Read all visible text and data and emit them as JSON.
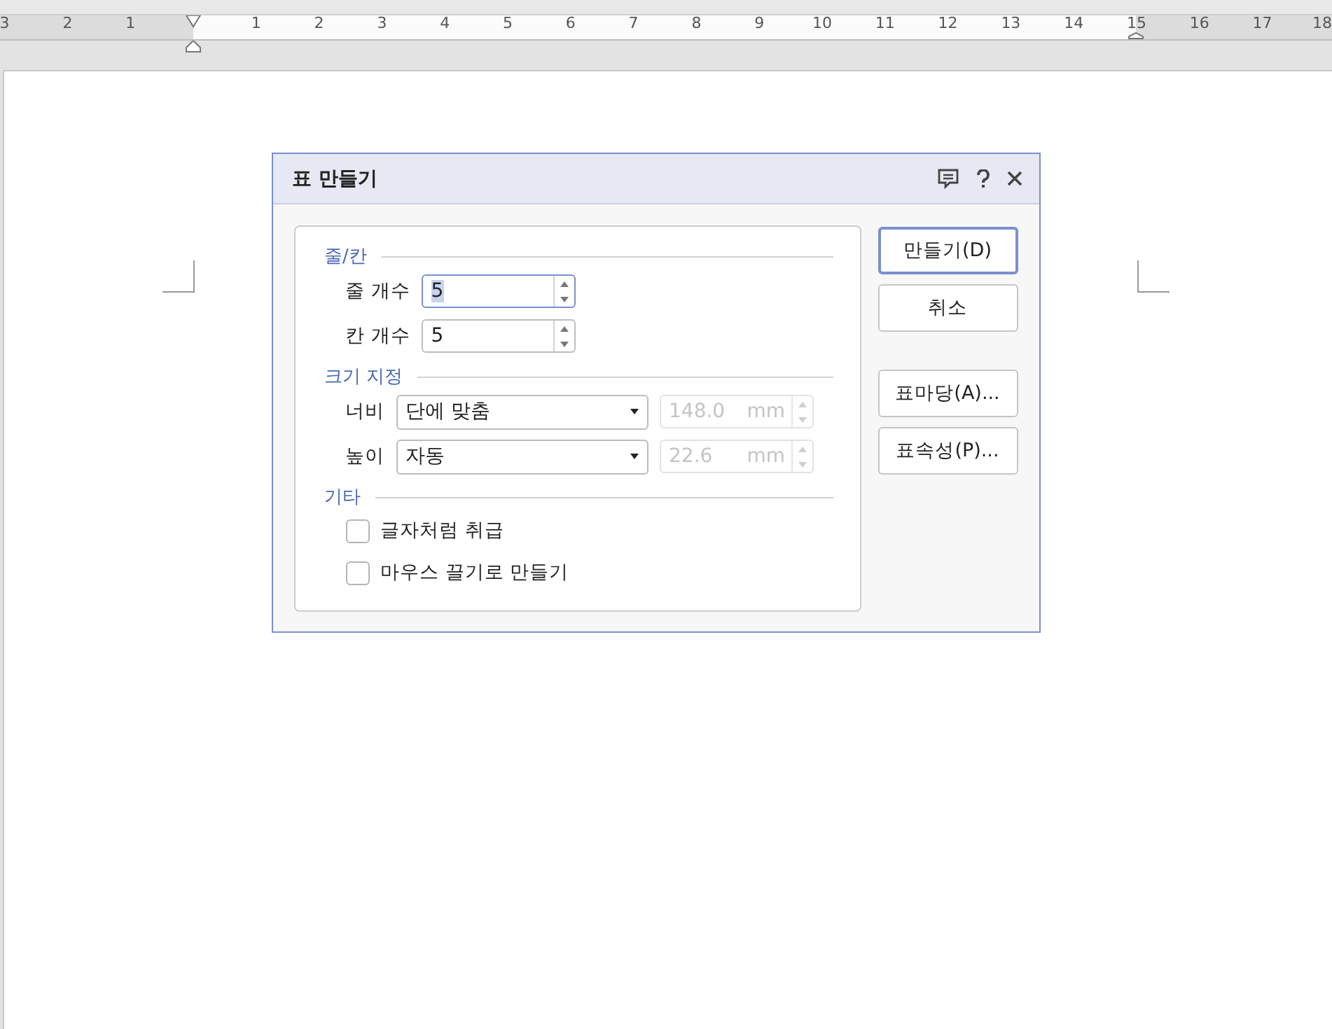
{
  "ruler": {
    "numbers": [
      "3",
      "2",
      "1",
      "1",
      "2",
      "3",
      "4",
      "5",
      "6",
      "7",
      "8",
      "9",
      "10",
      "11",
      "12",
      "13",
      "14",
      "15",
      "16",
      "17",
      "18"
    ]
  },
  "dialog": {
    "title": "표 만들기",
    "sections": [
      {
        "title": "줄/칸",
        "rows": [
          {
            "kind": "spinner",
            "label": "줄 개수",
            "value": "5",
            "focused": true
          },
          {
            "kind": "spinner",
            "label": "칸 개수",
            "value": "5",
            "focused": false
          }
        ]
      },
      {
        "title": "크기 지정",
        "rows": [
          {
            "kind": "size",
            "label": "너비",
            "choice": "단에 맞춤",
            "amount": "148.0",
            "unit": "mm",
            "disabled": true
          },
          {
            "kind": "size",
            "label": "높이",
            "choice": "자동",
            "amount": "22.6",
            "unit": "mm",
            "disabled": true
          }
        ]
      },
      {
        "title": "기타",
        "rows": [
          {
            "kind": "checkbox",
            "label": "글자처럼 취급",
            "checked": false
          },
          {
            "kind": "checkbox",
            "label": "마우스 끌기로 만들기",
            "checked": false
          }
        ]
      }
    ],
    "buttons": [
      {
        "label": "만들기(D)",
        "default": true
      },
      {
        "label": "취소",
        "default": false
      },
      {
        "label": "표마당(A)...",
        "default": false
      },
      {
        "label": "표속성(P)...",
        "default": false
      }
    ]
  }
}
